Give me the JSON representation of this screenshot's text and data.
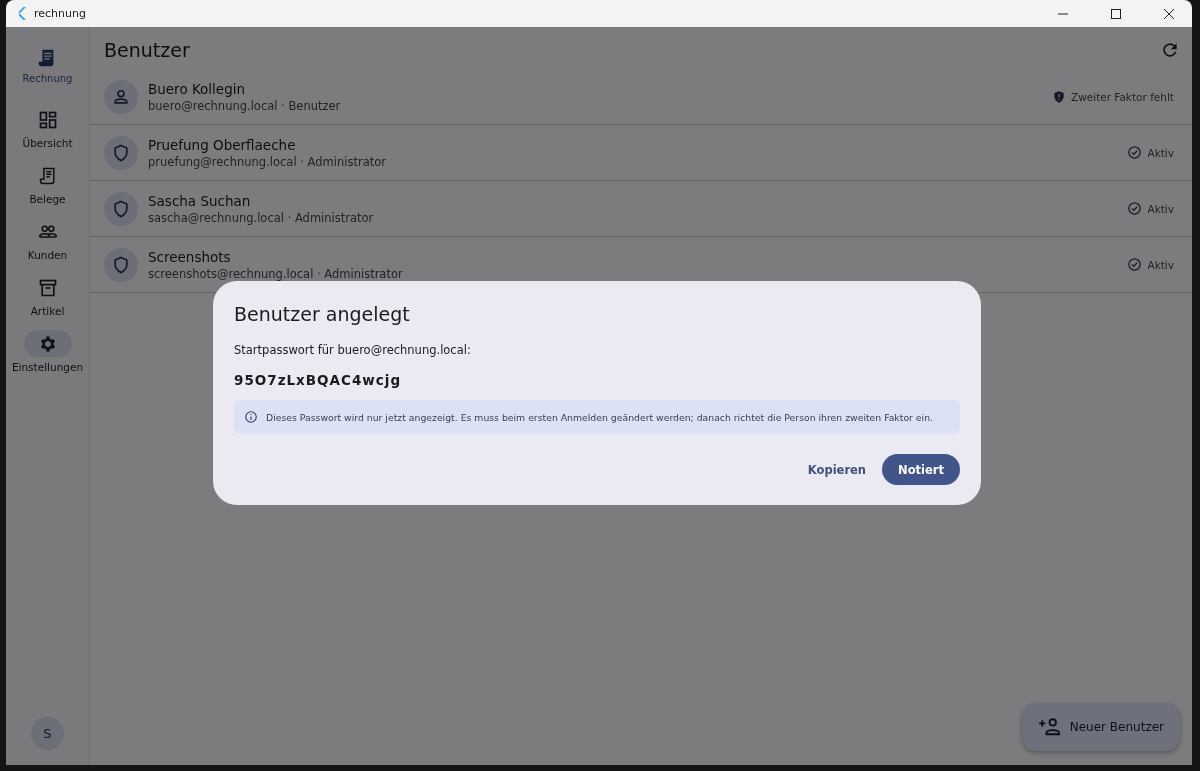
{
  "window": {
    "title": "rechnung"
  },
  "sidebar": {
    "brand": "Rechnung",
    "items": [
      {
        "label": "Übersicht",
        "kind": "dashboard",
        "selected": false
      },
      {
        "label": "Belege",
        "kind": "receipt",
        "selected": false
      },
      {
        "label": "Kunden",
        "kind": "people",
        "selected": false
      },
      {
        "label": "Artikel",
        "kind": "archive",
        "selected": false
      },
      {
        "label": "Einstellungen",
        "kind": "settings",
        "selected": true
      }
    ],
    "avatar": "S"
  },
  "page": {
    "title": "Benutzer"
  },
  "users": [
    {
      "name": "Buero Kollegin",
      "subtitle": "buero@rechnung.local · Benutzer",
      "kind": "user",
      "status": {
        "text": "Zweiter Faktor fehlt",
        "kind": "warning"
      }
    },
    {
      "name": "Pruefung Oberflaeche",
      "subtitle": "pruefung@rechnung.local · Administrator",
      "kind": "admin",
      "status": {
        "text": "Aktiv",
        "kind": "active"
      }
    },
    {
      "name": "Sascha Suchan",
      "subtitle": "sascha@rechnung.local · Administrator",
      "kind": "admin",
      "status": {
        "text": "Aktiv",
        "kind": "active"
      }
    },
    {
      "name": "Screenshots",
      "subtitle": "screenshots@rechnung.local · Administrator",
      "kind": "admin",
      "status": {
        "text": "Aktiv",
        "kind": "active"
      }
    }
  ],
  "fab": {
    "label": "Neuer Benutzer"
  },
  "dialog": {
    "title": "Benutzer angelegt",
    "text": "Startpasswort für buero@rechnung.local:",
    "password": "95O7zLxBQAC4wcjg",
    "info": "Dieses Passwort wird nur jetzt angezeigt. Es muss beim ersten Anmelden geändert werden; danach richtet die Person ihren zweiten Faktor ein.",
    "buttons": [
      {
        "label": "Kopieren",
        "kind": "text"
      },
      {
        "label": "Notiert",
        "kind": "filled"
      }
    ]
  }
}
